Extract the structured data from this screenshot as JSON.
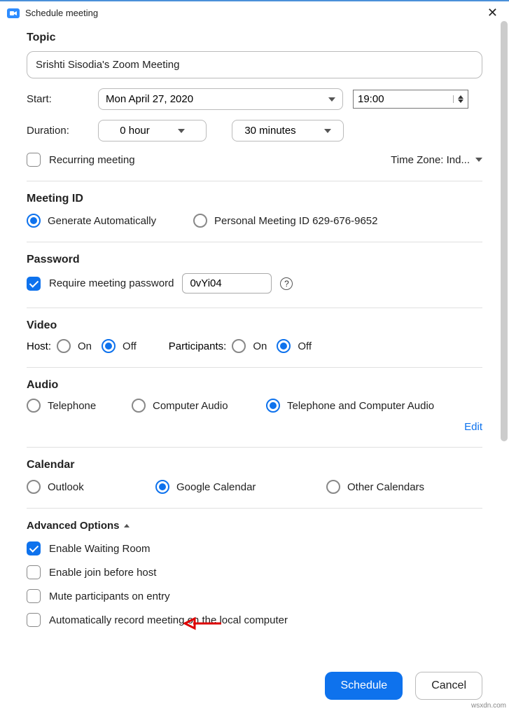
{
  "titlebar": {
    "title": "Schedule meeting"
  },
  "topic": {
    "label": "Topic",
    "value": "Srishti Sisodia's Zoom Meeting"
  },
  "start": {
    "label": "Start:",
    "date": "Mon  April 27, 2020",
    "time": "19:00"
  },
  "duration": {
    "label": "Duration:",
    "hours": "0 hour",
    "minutes": "30 minutes"
  },
  "recurring": {
    "label": "Recurring meeting"
  },
  "timezone": {
    "label": "Time Zone: Ind..."
  },
  "meeting_id": {
    "title": "Meeting ID",
    "auto": "Generate Automatically",
    "personal": "Personal Meeting ID 629-676-9652"
  },
  "password": {
    "title": "Password",
    "require": "Require meeting password",
    "value": "0vYi04"
  },
  "video": {
    "title": "Video",
    "host": "Host:",
    "participants": "Participants:",
    "on": "On",
    "off": "Off"
  },
  "audio": {
    "title": "Audio",
    "telephone": "Telephone",
    "computer": "Computer Audio",
    "both": "Telephone and Computer Audio",
    "edit": "Edit"
  },
  "calendar": {
    "title": "Calendar",
    "outlook": "Outlook",
    "google": "Google Calendar",
    "other": "Other Calendars"
  },
  "advanced": {
    "title": "Advanced Options",
    "waiting": "Enable Waiting Room",
    "join_before": "Enable join before host",
    "mute": "Mute participants on entry",
    "record": "Automatically record meeting on the local computer"
  },
  "footer": {
    "schedule": "Schedule",
    "cancel": "Cancel"
  },
  "watermark": "wsxdn.com"
}
